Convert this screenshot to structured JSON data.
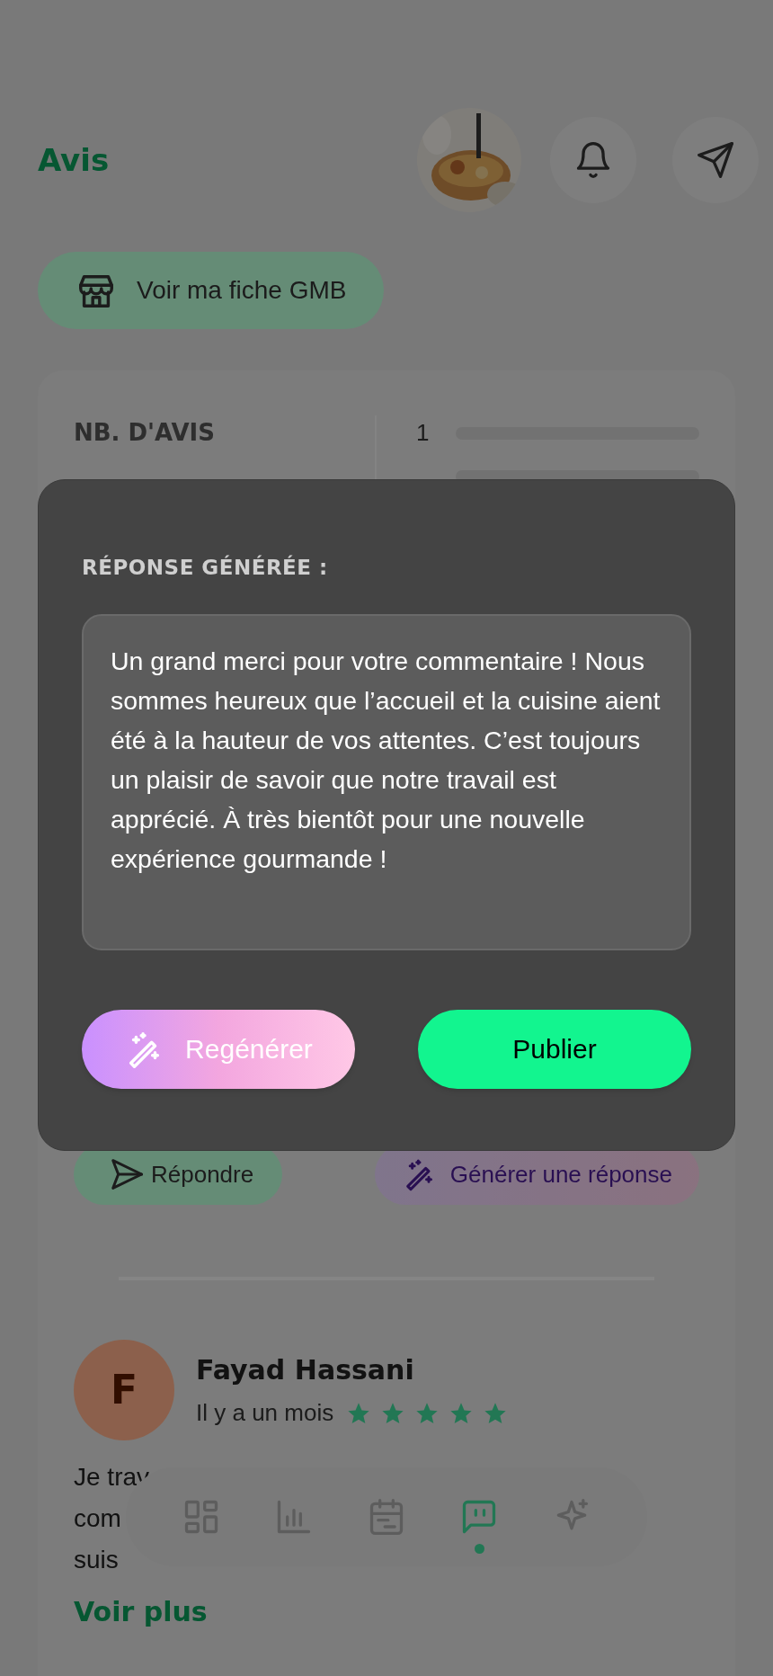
{
  "header": {
    "title": "Avis"
  },
  "gmb_button": {
    "label": "Voir ma fiche GMB"
  },
  "stats": {
    "label": "NB. D'AVIS",
    "rating_rows": [
      {
        "label": "1",
        "level": 0
      },
      {
        "level": 0
      }
    ]
  },
  "review_actions": [
    {
      "kind": "reply",
      "label": "Répondre"
    },
    {
      "kind": "generate",
      "label": "Générer une réponse"
    }
  ],
  "review": {
    "initial": "F",
    "name": "Fayad Hassani",
    "time": "Il y a un mois",
    "stars": 5,
    "text_lines": [
      "Je trav",
      "com",
      "suis"
    ],
    "more": "Voir plus"
  },
  "nav": [
    {
      "kind": "dashboard",
      "selected": false
    },
    {
      "kind": "stats",
      "selected": false
    },
    {
      "kind": "calendar",
      "selected": false
    },
    {
      "kind": "reviews",
      "selected": true
    },
    {
      "kind": "ai",
      "selected": false
    }
  ],
  "modal": {
    "title": "RÉPONSE GÉNÉRÉE :",
    "response": "Un grand merci pour votre commentaire ! Nous sommes heureux que l’accueil et la cuisine aient été à la hauteur de vos attentes. C’est toujours un plaisir de savoir que notre travail est apprécié. À très bientôt pour une nouvelle expérience gourmande !",
    "buttons": [
      {
        "kind": "regenerate",
        "label": "Regénérer"
      },
      {
        "kind": "publish",
        "label": "Publier"
      }
    ]
  }
}
